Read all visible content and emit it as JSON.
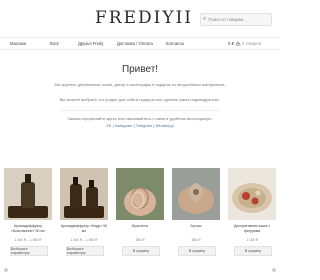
{
  "header": {
    "logo": "FREDIYII",
    "search_placeholder": "Поиск по товарам..."
  },
  "nav": {
    "items": [
      "Магазин",
      "Блог",
      "Друзья Fredy",
      "Доставка / Оплата",
      "Контакты"
    ],
    "cart_amount": "0 ₽",
    "cart_label": "0 товаров"
  },
  "hero": {
    "title": "Привет!",
    "line1": "Мы круглые деревянные полки, декор и аксессуары в подарок из натуральных материалов.",
    "line2": "Вы можете выбрать что угодно для себя в подарок или сделать заказ индивидуально.",
    "line3": "Заказы оформляйте здесь или связывайтесь с нами в удобном мессенджере:",
    "links": [
      "VK",
      "Instagram",
      "Telegram",
      "WhatsApp"
    ]
  },
  "products": [
    {
      "name": "Аромадиффузор «Благовоние» 50 мл",
      "price": "1 300 ₽ – 1 800 ₽",
      "button": "Выберите параметры",
      "colors": {
        "bg": "#d9cfc1",
        "glass": "#4a3a24"
      }
    },
    {
      "name": "Аромадиффузор «Кедр» 50 мл",
      "price": "1 300 ₽ – 1 800 ₽",
      "button": "Выберите параметры",
      "colors": {
        "bg": "#cfc3b2",
        "glass": "#3b2a17"
      }
    },
    {
      "name": "Браслеты",
      "price": "350 ₽",
      "button": "В корзину",
      "colors": {
        "bg": "#7d8a6c",
        "glass": "#c99b7e"
      }
    },
    {
      "name": "Брошь",
      "price": "650 ₽",
      "button": "В корзину",
      "colors": {
        "bg": "#9a9f99",
        "glass": "#c8b8a2"
      }
    },
    {
      "name": "Декоративная чаша с фигурами",
      "price": "1 150 ₽",
      "button": "В корзину",
      "colors": {
        "bg": "#ece6de",
        "glass": "#b84030"
      }
    }
  ]
}
